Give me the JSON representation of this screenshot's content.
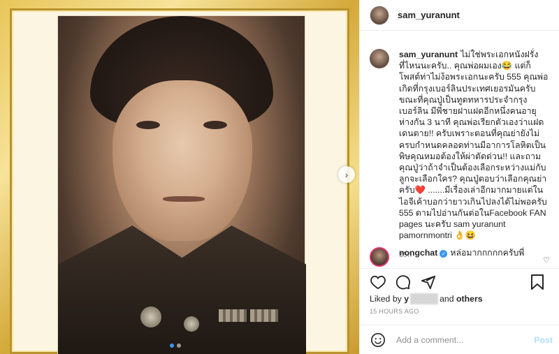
{
  "header": {
    "username": "sam_yuranunt"
  },
  "caption": {
    "username": "sam_yuranunt",
    "text": "ไม่ใช่พระเอกหนังฝรั่งที่ไหนนะครับ.. คุณพ่อผมเอง😂 แต่ก็โพสต์ท่าไม่ง้อพระเอกนะครับ 555 คุณพ่อเกิดที่กรุงเบอร์ลินประเทศเยอรมันครับขณะที่คุณปู่เป็นทูตทหารประจำกรุงเบอร์ลิน มีพี่ชายฝาแฝดอีกหนึ่งคนอายุห่างกัน 3 นาที คุณพ่อเรียกตัวเองว่าแฝดเดนตาย!! ครับเพราะตอนที่คุณย่ายังไม่ครบกำหนดคลอดท่านมีอาการโลหิตเป็นพิษคุณหมอต้องให้ผ่าตัดด่วน!! และถามคุณปู่ว่าถ้าจำเป็นต้องเลือกระหว่างแม่กับลูกจะเลือกใคร? คุณปู่ตอบว่าเลือกคุณย่าครับ❤️ .......มีเรื่องเล่าอีกมากมายแต่ในไอจีเค้าบอกว่ายาวเกินไปลงได้ไม่พอครับ 555 ตามไปอ่านกันต่อในFacebook FAN pages นะครับ sam yuranunt pamornmontri 👌😆",
    "time": "15h"
  },
  "comment": {
    "username": "nongchat",
    "text": "หล่อมากกกกกครับพี่"
  },
  "likes": {
    "prefix": "Liked by",
    "user_partial": "y",
    "suffix_and": "and",
    "others": "others"
  },
  "posted": "15 HOURS AGO",
  "add_comment": {
    "placeholder": "Add a comment...",
    "post_label": "Post"
  },
  "colors": {
    "accent": "#3897f0",
    "post_disabled": "#b2dffc",
    "frame_gold": "#d4a93a"
  },
  "icons": [
    "heart-icon",
    "comment-icon",
    "share-icon",
    "bookmark-icon",
    "emoji-icon",
    "chevron-right-icon",
    "verified-icon"
  ]
}
